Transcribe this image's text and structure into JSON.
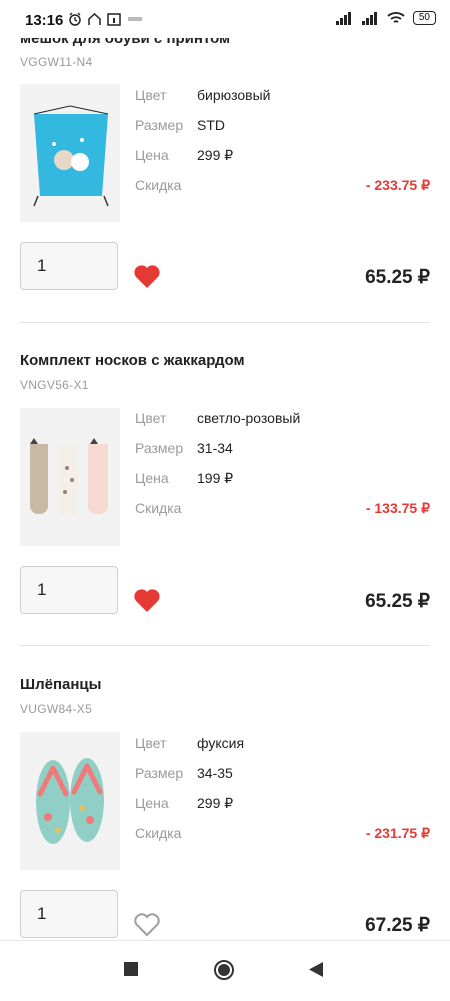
{
  "status_bar": {
    "time": "13:16",
    "battery": "50"
  },
  "products": [
    {
      "title": "мешок для обуви с принтом",
      "sku": "VGGW11-N4",
      "image": "drawstring-bag-image",
      "color_label": "Цвет",
      "color_value": "бирюзовый",
      "size_label": "Размер",
      "size_value": "STD",
      "price_label": "Цена",
      "price_value": "299 ₽",
      "discount_label": "Скидка",
      "discount_value": "- 233.75 ₽",
      "quantity": "1",
      "favorite": true,
      "total": "65.25 ₽"
    },
    {
      "title": "Комплект носков с жаккардом",
      "sku": "VNGV56-X1",
      "image": "socks-image",
      "color_label": "Цвет",
      "color_value": "светло-розовый",
      "size_label": "Размер",
      "size_value": "31-34",
      "price_label": "Цена",
      "price_value": "199 ₽",
      "discount_label": "Скидка",
      "discount_value": "- 133.75 ₽",
      "quantity": "1",
      "favorite": true,
      "total": "65.25 ₽"
    },
    {
      "title": "Шлёпанцы",
      "sku": "VUGW84-X5",
      "image": "flip-flops-image",
      "color_label": "Цвет",
      "color_value": "фуксия",
      "size_label": "Размер",
      "size_value": "34-35",
      "price_label": "Цена",
      "price_value": "299 ₽",
      "discount_label": "Скидка",
      "discount_value": "- 231.75 ₽",
      "quantity": "1",
      "favorite": false,
      "total": "67.25 ₽"
    }
  ],
  "colors": {
    "discount": "#e53935",
    "heart": "#e53935",
    "heart_outline": "#9e9e9e"
  },
  "nav": {
    "items": [
      "recents-square-icon",
      "home-circle-icon",
      "back-triangle-icon"
    ]
  }
}
